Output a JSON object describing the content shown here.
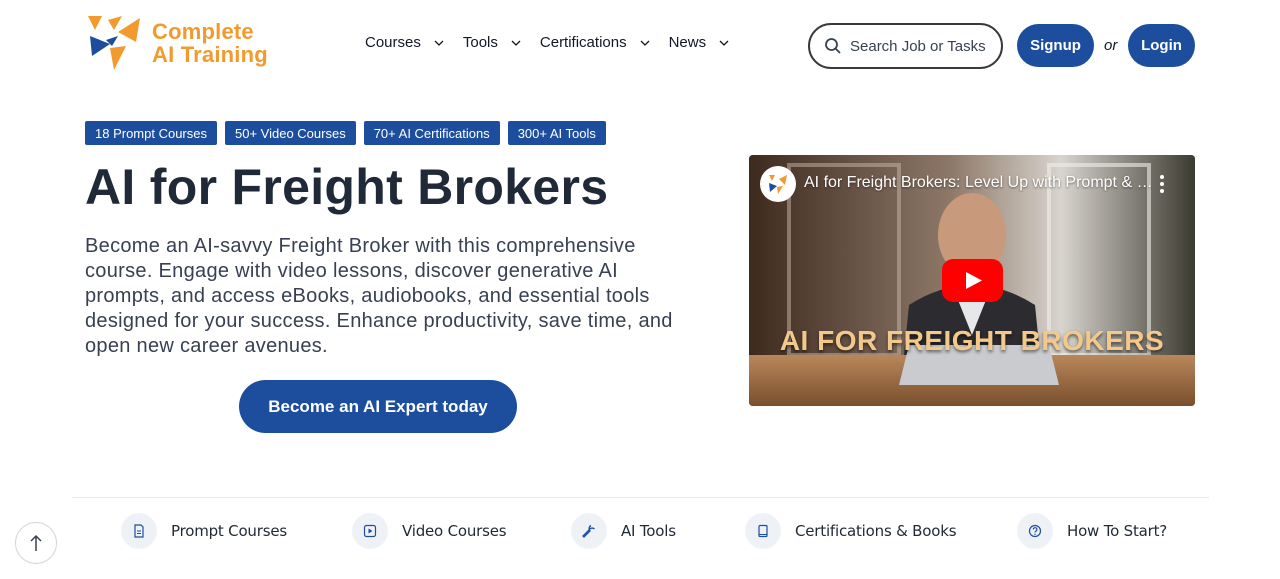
{
  "logo": {
    "line1": "Complete",
    "line2": "AI Training",
    "color": "#f29a2e"
  },
  "nav": [
    {
      "label": "Courses",
      "icon": "chevron-down-icon"
    },
    {
      "label": "Tools",
      "icon": "chevron-down-icon"
    },
    {
      "label": "Certifications",
      "icon": "chevron-down-icon"
    },
    {
      "label": "News",
      "icon": "chevron-down-icon"
    }
  ],
  "search": {
    "placeholder": "Search Job or Tasks",
    "icon": "search-icon"
  },
  "auth": {
    "signup": "Signup",
    "or": "or",
    "login": "Login"
  },
  "badges": [
    "18 Prompt Courses",
    "50+ Video Courses",
    "70+ AI Certifications",
    "300+ AI Tools"
  ],
  "hero": {
    "title": "AI for Freight Brokers",
    "description": "Become an AI-savvy Freight Broker with this comprehensive course. Engage with video lessons, discover generative AI prompts, and access eBooks, audiobooks, and essential tools designed for your success. Enhance productivity, save time, and open new career avenues.",
    "cta": "Become an AI Expert today"
  },
  "video": {
    "title": "AI for Freight Brokers: Level Up with Prompt & …",
    "overlay_text": "AI FOR FREIGHT BROKERS",
    "play_icon": "play-icon",
    "more_icon": "more-vert-icon"
  },
  "bottom_nav": [
    {
      "label": "Prompt Courses",
      "icon": "document-icon"
    },
    {
      "label": "Video Courses",
      "icon": "video-icon"
    },
    {
      "label": "AI Tools",
      "icon": "wrench-icon"
    },
    {
      "label": "Certifications & Books",
      "icon": "book-icon"
    },
    {
      "label": "How To Start?",
      "icon": "question-icon"
    }
  ],
  "colors": {
    "primary": "#1d4e9e",
    "accent": "#f29a2e",
    "text": "#1f2937"
  }
}
